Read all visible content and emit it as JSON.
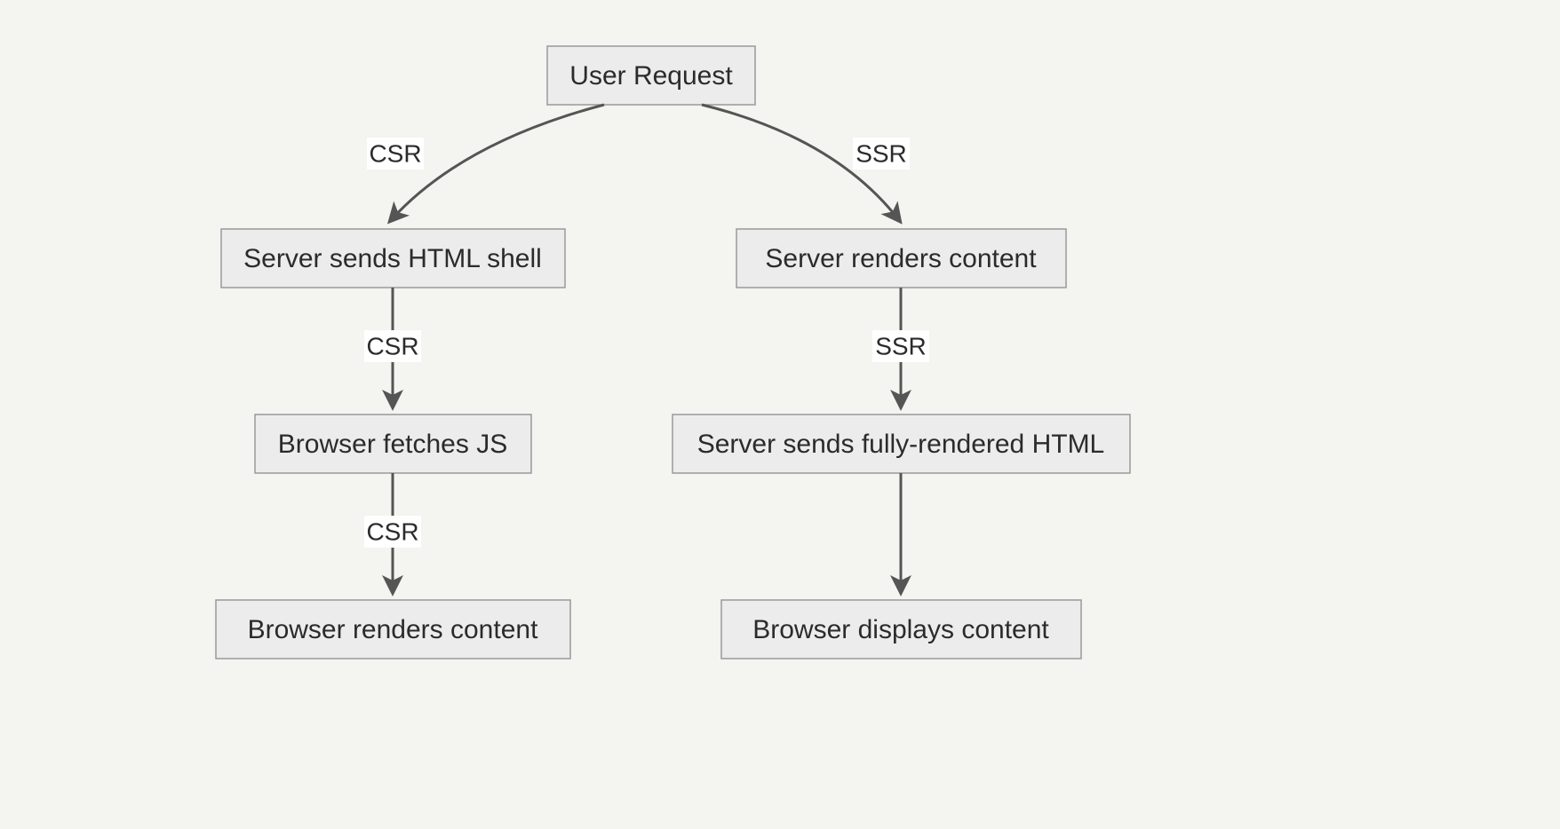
{
  "chart_data": {
    "type": "flowchart",
    "nodes": [
      {
        "id": "user_request",
        "label": "User Request"
      },
      {
        "id": "csr_shell",
        "label": "Server sends HTML shell"
      },
      {
        "id": "csr_fetch_js",
        "label": "Browser fetches JS"
      },
      {
        "id": "csr_render",
        "label": "Browser renders content"
      },
      {
        "id": "ssr_render",
        "label": "Server renders content"
      },
      {
        "id": "ssr_send_html",
        "label": "Server sends fully-rendered HTML"
      },
      {
        "id": "ssr_display",
        "label": "Browser displays content"
      }
    ],
    "edges": [
      {
        "from": "user_request",
        "to": "csr_shell",
        "label": "CSR"
      },
      {
        "from": "csr_shell",
        "to": "csr_fetch_js",
        "label": "CSR"
      },
      {
        "from": "csr_fetch_js",
        "to": "csr_render",
        "label": "CSR"
      },
      {
        "from": "user_request",
        "to": "ssr_render",
        "label": "SSR"
      },
      {
        "from": "ssr_render",
        "to": "ssr_send_html",
        "label": "SSR"
      },
      {
        "from": "ssr_send_html",
        "to": "ssr_display",
        "label": ""
      }
    ]
  },
  "nodes": {
    "user_request": "User Request",
    "csr_shell": "Server sends HTML shell",
    "csr_fetch_js": "Browser fetches JS",
    "csr_render": "Browser renders content",
    "ssr_render": "Server renders content",
    "ssr_send_html": "Server sends fully-rendered HTML",
    "ssr_display": "Browser displays content"
  },
  "edges": {
    "e1": "CSR",
    "e2": "CSR",
    "e3": "CSR",
    "e4": "SSR",
    "e5": "SSR",
    "e6": ""
  }
}
